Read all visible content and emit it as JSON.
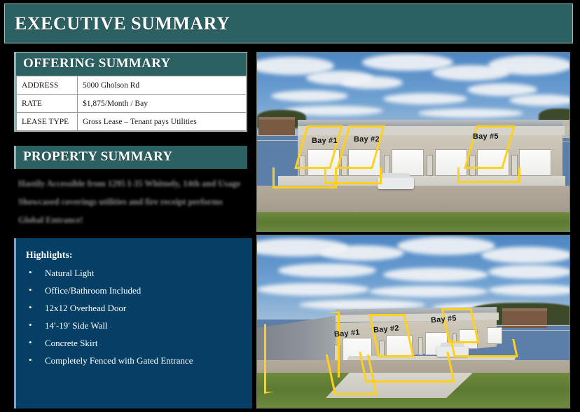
{
  "header": {
    "title": "EXECUTIVE SUMMARY",
    "accent_color": "#2b6163"
  },
  "offering_summary": {
    "title": "OFFERING SUMMARY",
    "rows": [
      {
        "label": "ADDRESS",
        "value": "5000 Gholson Rd"
      },
      {
        "label": "RATE",
        "value": "$1,875/Month /  Bay"
      },
      {
        "label": "LEASE TYPE",
        "value": "Gross Lease – Tenant pays Utilities"
      }
    ]
  },
  "property_summary": {
    "title": "PROPERTY SUMMARY",
    "redacted": true,
    "paragraphs": [
      "Hastily Accessible from 1295 I-35 Whitnely, 14th and Usage",
      "Showcased coverings utilities and fire receipt performs",
      "Global Entrance!"
    ]
  },
  "highlights": {
    "title": "Highlights:",
    "background_color": "#053f66",
    "items": [
      "Natural Light",
      "Office/Bathroom Included",
      "12x12 Overhead Door",
      "14′-19′ Side Wall",
      "Concrete Skirt",
      "Completely Fenced with Gated Entrance"
    ]
  },
  "photos": [
    {
      "name": "front-elevation-photo",
      "caption_labels": [
        "Bay #1",
        "Bay #2",
        "Bay #5"
      ],
      "highlight_color": "#ffd11a"
    },
    {
      "name": "aerial-angle-photo",
      "caption_labels": [
        "Bay #1",
        "Bay #2",
        "Bay #5"
      ],
      "highlight_color": "#ffd11a"
    }
  ]
}
